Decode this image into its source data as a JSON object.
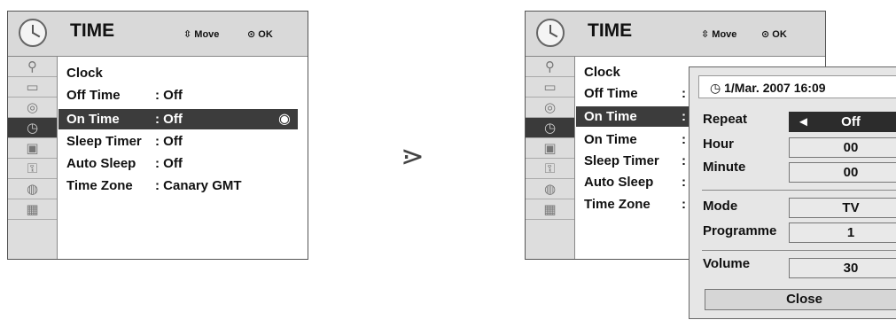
{
  "left": {
    "title": "TIME",
    "move_label": "Move",
    "ok_label": "OK",
    "rows": [
      {
        "name": "Clock",
        "value": ""
      },
      {
        "name": "Off Time",
        "value": ": Off"
      },
      {
        "name": "On Time",
        "value": ": Off"
      },
      {
        "name": "Sleep Timer",
        "value": ": Off"
      },
      {
        "name": "Auto Sleep",
        "value": ": Off"
      },
      {
        "name": "Time Zone",
        "value": ": Canary GMT"
      }
    ]
  },
  "arrow": "⋗",
  "right": {
    "title": "TIME",
    "move_label": "Move",
    "ok_label": "OK",
    "rows": [
      "Clock",
      "Off Time",
      "On Time",
      "On Time",
      "Sleep Timer",
      "Auto Sleep",
      "Time Zone"
    ],
    "colon": ":",
    "popup": {
      "datetime": "1/Mar. 2007 16:09",
      "repeat_label": "Repeat",
      "repeat_value": "Off",
      "hour_label": "Hour",
      "hour_value": "00",
      "minute_label": "Minute",
      "minute_value": "00",
      "mode_label": "Mode",
      "mode_value": "TV",
      "programme_label": "Programme",
      "programme_value": "1",
      "volume_label": "Volume",
      "volume_value": "30",
      "close_label": "Close"
    }
  },
  "icons": [
    "satellite-icon",
    "monitor-icon",
    "speaker-icon",
    "clock-icon",
    "toolbox-icon",
    "lock-icon",
    "globe-icon",
    "media-icon"
  ]
}
